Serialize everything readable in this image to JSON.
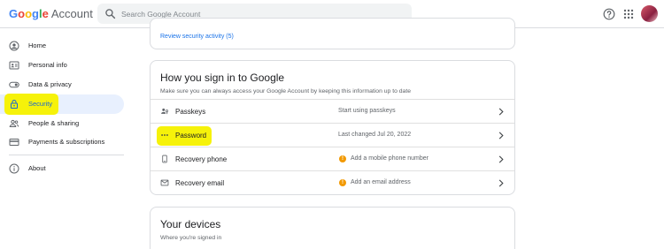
{
  "header": {
    "logo_word": "Google",
    "logo_letters": [
      "G",
      "o",
      "o",
      "g",
      "l",
      "e"
    ],
    "logo_colors": [
      "#4285F4",
      "#EA4335",
      "#FBBC05",
      "#4285F4",
      "#34A853",
      "#EA4335"
    ],
    "app_name": "Account",
    "search_placeholder": "Search Google Account"
  },
  "sidebar": {
    "items": [
      {
        "label": "Home",
        "icon": "home-icon"
      },
      {
        "label": "Personal info",
        "icon": "id-card-icon"
      },
      {
        "label": "Data & privacy",
        "icon": "toggle-icon"
      },
      {
        "label": "Security",
        "icon": "lock-icon",
        "active": true
      },
      {
        "label": "People & sharing",
        "icon": "people-icon"
      },
      {
        "label": "Payments & subscriptions",
        "icon": "credit-card-icon"
      },
      {
        "label": "About",
        "icon": "info-icon"
      }
    ]
  },
  "security_activity": {
    "link": "Review security activity (5)"
  },
  "signin": {
    "title": "How you sign in to Google",
    "subtitle": "Make sure you can always access your Google Account by keeping this information up to date",
    "rows": [
      {
        "label": "Passkeys",
        "value": "Start using passkeys",
        "icon": "passkey-icon",
        "warning": false
      },
      {
        "label": "Password",
        "value": "Last changed Jul 20, 2022",
        "icon": "password-dots-icon",
        "warning": false
      },
      {
        "label": "Recovery phone",
        "value": "Add a mobile phone number",
        "icon": "phone-icon",
        "warning": true
      },
      {
        "label": "Recovery email",
        "value": "Add an email address",
        "icon": "email-icon",
        "warning": true
      }
    ],
    "warning_glyph": "!"
  },
  "devices": {
    "title": "Your devices",
    "subtitle": "Where you're signed in"
  },
  "colors": {
    "accent": "#1a73e8",
    "active_bg": "#e8f0fe",
    "highlight": "#f6f20a",
    "warning": "#f29900"
  }
}
